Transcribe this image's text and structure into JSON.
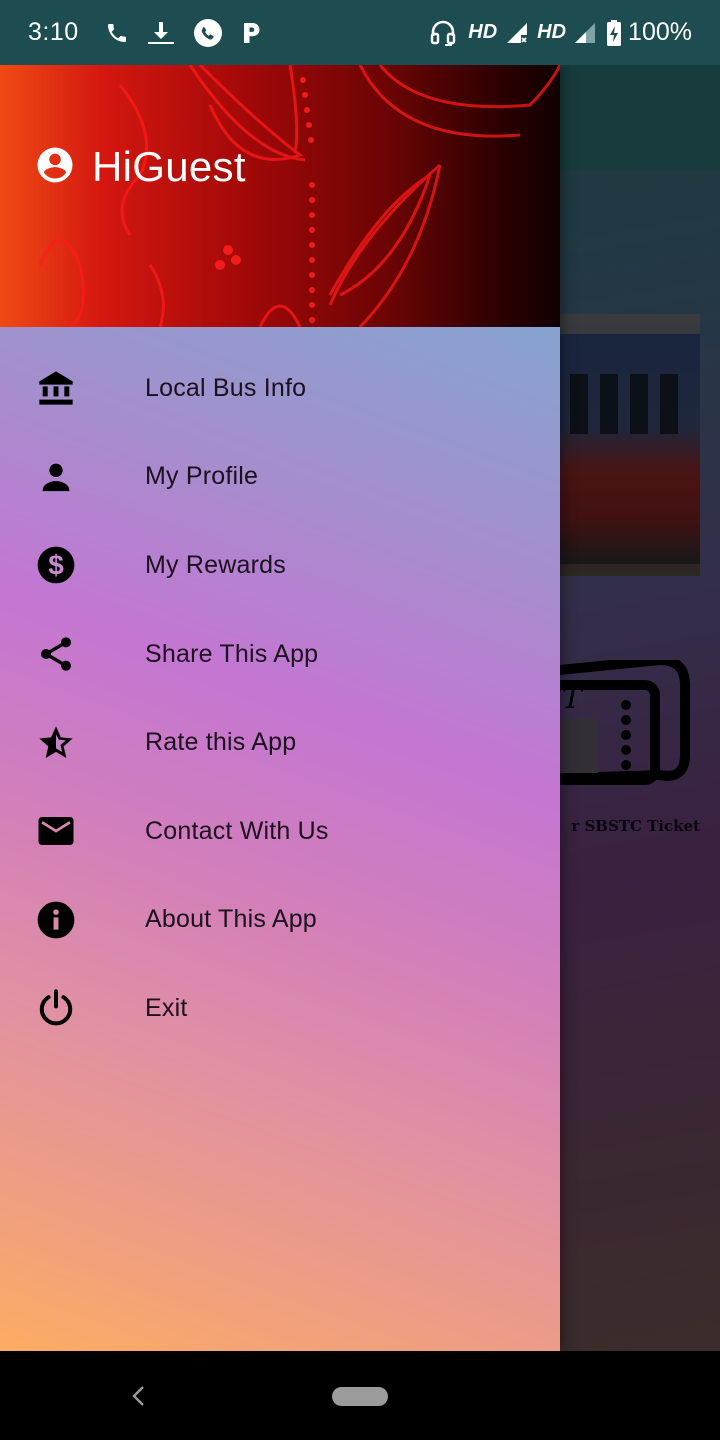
{
  "status_bar": {
    "time": "3:10",
    "left_icons": [
      "phone-icon",
      "download-icon",
      "whatsapp-icon",
      "parking-p-icon"
    ],
    "right_icons": [
      "headset-icon",
      "hd-icon",
      "signal-no-data-icon",
      "hd-icon",
      "signal-icon",
      "battery-charging-icon"
    ],
    "hd_label_1": "HD",
    "hd_label_2": "HD",
    "battery": "100%"
  },
  "drawer": {
    "header": {
      "user_icon": "account-circle-icon",
      "greeting": "HiGuest"
    },
    "menu": [
      {
        "icon": "bank-icon",
        "label": "Local Bus Info"
      },
      {
        "icon": "person-icon",
        "label": "My Profile"
      },
      {
        "icon": "dollar-circle-icon",
        "label": "My Rewards"
      },
      {
        "icon": "share-icon",
        "label": "Share This App"
      },
      {
        "icon": "star-half-icon",
        "label": "Rate this App"
      },
      {
        "icon": "email-icon",
        "label": "Contact With Us"
      },
      {
        "icon": "info-icon",
        "label": "About This App"
      },
      {
        "icon": "power-icon",
        "label": "Exit"
      }
    ]
  },
  "background_app": {
    "ticket_partial_text": "ET",
    "ticket_caption_partial": "r SBSTC Ticket"
  },
  "nav_bar": {
    "back": "back-icon",
    "home": "home-pill"
  }
}
